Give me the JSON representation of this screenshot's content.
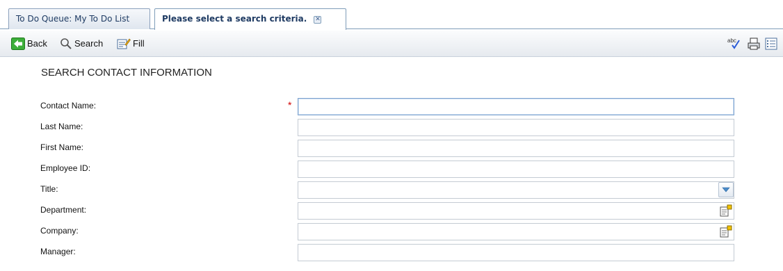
{
  "tabs": [
    {
      "label": "To Do Queue: My To Do List",
      "active": false
    },
    {
      "label": "Please select a search criteria.",
      "active": true
    }
  ],
  "toolbar": {
    "back_label": "Back",
    "search_label": "Search",
    "fill_label": "Fill",
    "icons": [
      "back-arrow-icon",
      "magnifier-icon",
      "fill-form-icon",
      "spellcheck-icon",
      "print-icon",
      "list-view-icon"
    ]
  },
  "form": {
    "title": "SEARCH CONTACT INFORMATION",
    "required_mark": "*",
    "fields": [
      {
        "label": "Contact Name:",
        "value": "",
        "required": true
      },
      {
        "label": "Last Name:",
        "value": ""
      },
      {
        "label": "First Name:",
        "value": ""
      },
      {
        "label": "Employee ID:",
        "value": ""
      },
      {
        "label": "Title:",
        "value": "",
        "control": "dropdown"
      },
      {
        "label": "Department:",
        "value": "",
        "control": "lookup"
      },
      {
        "label": "Company:",
        "value": "",
        "control": "lookup"
      },
      {
        "label": "Manager:",
        "value": ""
      }
    ]
  },
  "colors": {
    "tab_border": "#7f9db9",
    "tab_text": "#1f3b63",
    "required": "#d00000",
    "focus_border": "#7da2ce"
  }
}
